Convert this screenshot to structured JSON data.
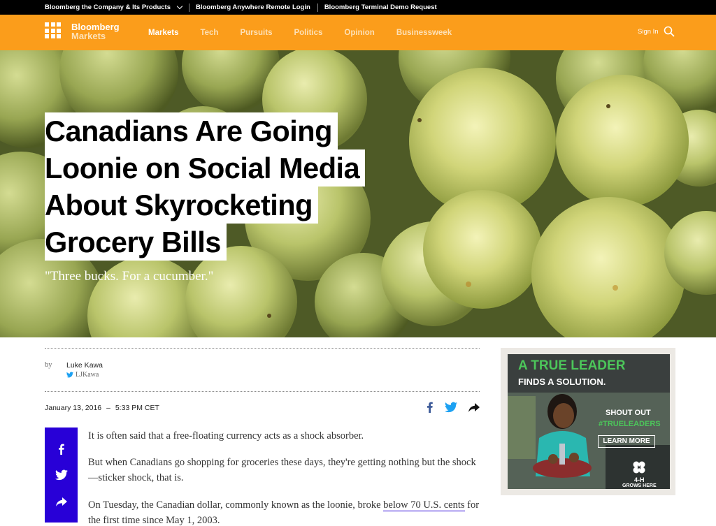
{
  "topbar": {
    "item1": "Bloomberg the Company & Its Products",
    "item2": "Bloomberg Anywhere Remote Login",
    "item3": "Bloomberg Terminal Demo Request"
  },
  "nav": {
    "brand": "Bloomberg",
    "section": "Markets",
    "items": [
      "Markets",
      "Tech",
      "Pursuits",
      "Politics",
      "Opinion",
      "Businessweek"
    ],
    "signin": "Sign In"
  },
  "hero": {
    "headline_lines": [
      "Canadians Are Going",
      "Loonie on Social Media",
      "About Skyrocketing",
      "Grocery Bills"
    ],
    "dek": "\"Three bucks. For a cucumber.\""
  },
  "byline": {
    "by": "by",
    "author": "Luke Kawa",
    "handle": "LJKawa",
    "date": "January 13, 2016",
    "separator": "–",
    "time": "5:33 PM CET"
  },
  "body": {
    "p1": "It is often said that a free-floating currency acts as a shock absorber.",
    "p2": "But when Canadians go shopping for groceries these days, they're getting nothing but the shock—sticker shock, that is.",
    "p3_before": "On Tuesday, the Canadian dollar, commonly known as the loonie, broke ",
    "p3_link": "below 70 U.S. cents",
    "p3_after": " for the first time since May 1, 2003."
  },
  "ad": {
    "line1": "A TRUE LEADER",
    "line2": "FINDS A SOLUTION.",
    "line3": "SHOUT OUT",
    "line4": "#TRUELEADERS",
    "button": "LEARN MORE",
    "logo": "4-H",
    "logo_sub": "GROWS HERE"
  },
  "colors": {
    "nav_orange": "#fb9d1b",
    "share_blue": "#2800d7",
    "ad_green": "#4cc65a",
    "facebook": "#3b5998",
    "twitter": "#1da1f2"
  }
}
